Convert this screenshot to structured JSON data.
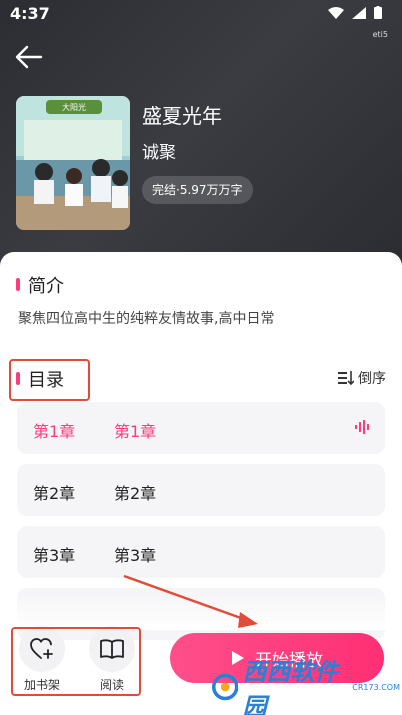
{
  "status_bar": {
    "time": "4:37",
    "carrier": "eti5"
  },
  "book": {
    "title": "盛夏光年",
    "author": "诚聚",
    "status": "完结·5.97万万字",
    "cover_sign": "大阳光"
  },
  "intro": {
    "heading": "简介",
    "text": "聚焦四位高中生的纯粹友情故事,高中日常"
  },
  "toc": {
    "heading": "目录",
    "sort_label": "倒序",
    "chapters": [
      {
        "num": "第1章",
        "name": "第1章"
      },
      {
        "num": "第2章",
        "name": "第2章"
      },
      {
        "num": "第3章",
        "name": "第3章"
      }
    ]
  },
  "actions": {
    "add_shelf": "加书架",
    "read": "阅读",
    "play": "开始播放"
  },
  "watermark": {
    "text": "西西软件园",
    "sub": "CR173.COM"
  },
  "colors": {
    "accent": "#ff3b7a",
    "annotation": "#e04b3a"
  }
}
